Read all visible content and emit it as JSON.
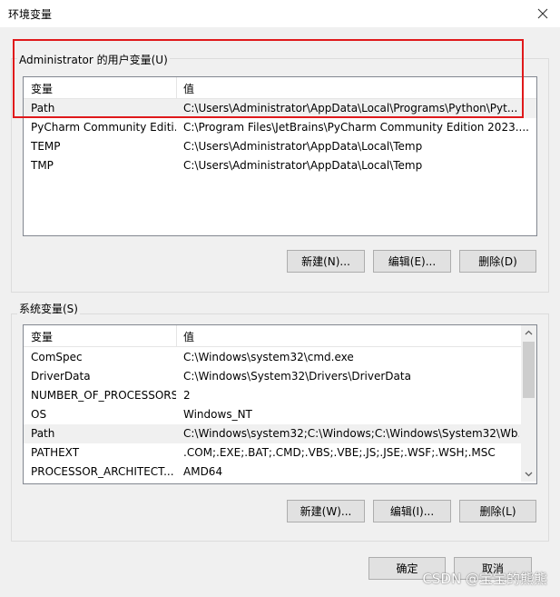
{
  "window": {
    "title": "环境变量"
  },
  "user_vars": {
    "group_label": "Administrator 的用户变量(U)",
    "col_name": "变量",
    "col_value": "值",
    "rows": [
      {
        "name": "Path",
        "value": "C:\\Users\\Administrator\\AppData\\Local\\Programs\\Python\\Pyt..."
      },
      {
        "name": "PyCharm Community Editi...",
        "value": "C:\\Program Files\\JetBrains\\PyCharm Community Edition 2023...."
      },
      {
        "name": "TEMP",
        "value": "C:\\Users\\Administrator\\AppData\\Local\\Temp"
      },
      {
        "name": "TMP",
        "value": "C:\\Users\\Administrator\\AppData\\Local\\Temp"
      }
    ],
    "btn_new": "新建(N)...",
    "btn_edit": "编辑(E)...",
    "btn_delete": "删除(D)"
  },
  "system_vars": {
    "group_label": "系统变量(S)",
    "col_name": "变量",
    "col_value": "值",
    "rows": [
      {
        "name": "ComSpec",
        "value": "C:\\Windows\\system32\\cmd.exe"
      },
      {
        "name": "DriverData",
        "value": "C:\\Windows\\System32\\Drivers\\DriverData"
      },
      {
        "name": "NUMBER_OF_PROCESSORS",
        "value": "2"
      },
      {
        "name": "OS",
        "value": "Windows_NT"
      },
      {
        "name": "Path",
        "value": "C:\\Windows\\system32;C:\\Windows;C:\\Windows\\System32\\Wb..."
      },
      {
        "name": "PATHEXT",
        "value": ".COM;.EXE;.BAT;.CMD;.VBS;.VBE;.JS;.JSE;.WSF;.WSH;.MSC"
      },
      {
        "name": "PROCESSOR_ARCHITECT...",
        "value": "AMD64"
      }
    ],
    "btn_new": "新建(W)...",
    "btn_edit": "编辑(I)...",
    "btn_delete": "删除(L)"
  },
  "footer": {
    "ok": "确定",
    "cancel": "取消"
  },
  "watermark": "CSDN @宝宝的熊熊",
  "colors": {
    "highlight": "#e0191b",
    "selected_row": "#f0f0f0"
  }
}
